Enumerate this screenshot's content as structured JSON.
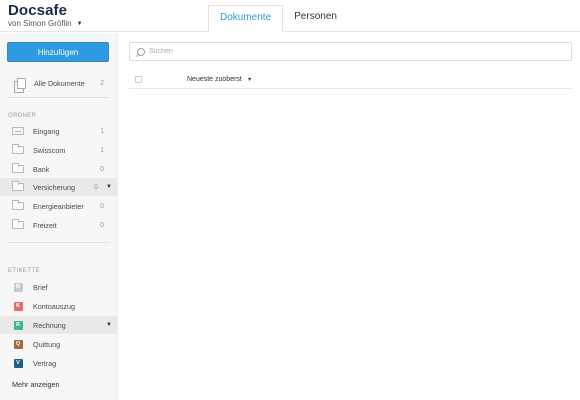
{
  "brand": {
    "title": "Docsafe",
    "owner": "von Simon Gröflin"
  },
  "tabs": [
    {
      "label": "Dokumente",
      "active": true
    },
    {
      "label": "Personen",
      "active": false
    }
  ],
  "sidebar": {
    "add_label": "Hinzufügen",
    "all_docs": {
      "label": "Alle Dokumente",
      "count": "2"
    },
    "folders_heading": "ORDNER",
    "folders": [
      {
        "label": "Eingang",
        "count": "1",
        "icon": "inbox-icon"
      },
      {
        "label": "Swisscom",
        "count": "1",
        "icon": "folder-icon"
      },
      {
        "label": "Bank",
        "count": "0",
        "icon": "folder-icon"
      },
      {
        "label": "Versicherung",
        "count": "0",
        "icon": "folder-icon",
        "selected": true
      },
      {
        "label": "Energieanbieter",
        "count": "0",
        "icon": "folder-icon"
      },
      {
        "label": "Freizeit",
        "count": "0",
        "icon": "folder-icon"
      }
    ],
    "tags_heading": "ETIKETTE",
    "tags": [
      {
        "letter": "B",
        "label": "Brief",
        "color": "#c9c9c9"
      },
      {
        "letter": "K",
        "label": "Kontoauszug",
        "color": "#e96a6a"
      },
      {
        "letter": "R",
        "label": "Rechnung",
        "color": "#3fb58a",
        "selected": true
      },
      {
        "letter": "Q",
        "label": "Quittung",
        "color": "#a6683b"
      },
      {
        "letter": "V",
        "label": "Vertrag",
        "color": "#1e5f86"
      }
    ],
    "more_label": "Mehr anzeigen"
  },
  "main": {
    "search_placeholder": "Suchen",
    "sort_label": "Neueste zuoberst"
  },
  "colors": {
    "accent": "#2f9ae0",
    "sidebar_bg": "#f7f7f7",
    "brand": "#1b2a4e"
  }
}
